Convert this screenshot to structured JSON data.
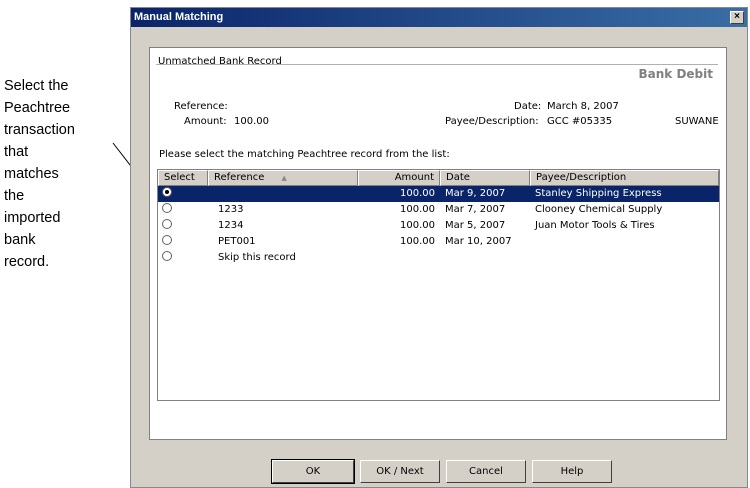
{
  "callout": {
    "lines": [
      "Select the",
      "Peachtree",
      "transaction",
      "that",
      "matches",
      "the",
      "imported",
      "bank",
      "record."
    ]
  },
  "window": {
    "title": "Manual Matching",
    "close_glyph": "×"
  },
  "bank_record": {
    "section_label": "Unmatched Bank Record",
    "type": "Bank Debit",
    "reference_label": "Reference:",
    "reference_value": "",
    "amount_label": "Amount:",
    "amount_value": "100.00",
    "date_label": "Date:",
    "date_value": "March 8, 2007",
    "payee_label": "Payee/Description:",
    "payee_value": "GCC #05335",
    "payee_extra": "SUWANE"
  },
  "list": {
    "prompt": "Please select the matching Peachtree record from the list:",
    "columns": [
      "Select",
      "Reference",
      "Amount",
      "Date",
      "Payee/Description"
    ],
    "sort_indicator": "▲",
    "rows": [
      {
        "selected": true,
        "reference": "",
        "amount": "100.00",
        "date": "Mar 9, 2007",
        "payee": "Stanley Shipping Express"
      },
      {
        "selected": false,
        "reference": "1233",
        "amount": "100.00",
        "date": "Mar 7, 2007",
        "payee": "Clooney Chemical Supply"
      },
      {
        "selected": false,
        "reference": "1234",
        "amount": "100.00",
        "date": "Mar 5, 2007",
        "payee": "Juan Motor Tools & Tires"
      },
      {
        "selected": false,
        "reference": "PET001",
        "amount": "100.00",
        "date": "Mar 10, 2007",
        "payee": ""
      },
      {
        "selected": false,
        "reference": "Skip this record",
        "amount": "",
        "date": "",
        "payee": ""
      }
    ]
  },
  "buttons": {
    "ok": "OK",
    "ok_next": "OK / Next",
    "cancel": "Cancel",
    "help": "Help"
  }
}
